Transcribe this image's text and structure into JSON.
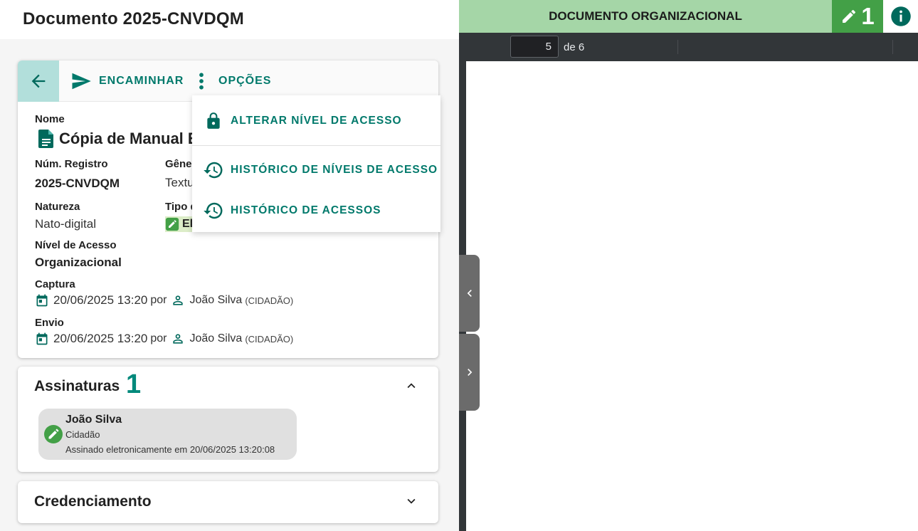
{
  "header": {
    "title": "Documento 2025-CNVDQM"
  },
  "toolbar": {
    "forward_label": "ENCAMINHAR",
    "options_label": "OPÇÕES"
  },
  "options_menu": {
    "items": [
      {
        "label": "ALTERAR NÍVEL DE ACESSO",
        "icon": "lock-icon"
      },
      {
        "label": "HISTÓRICO DE NÍVEIS DE ACESSO",
        "icon": "history-icon"
      },
      {
        "label": "HISTÓRICO DE ACESSOS",
        "icon": "history-icon"
      }
    ]
  },
  "details": {
    "name_label": "Nome",
    "name_value": "Cópia de Manual E-",
    "registro_label": "Núm. Registro",
    "registro_value": "2025-CNVDQM",
    "genero_label": "Gêner",
    "genero_value": "Textu",
    "natureza_label": "Natureza",
    "natureza_value": "Nato-digital",
    "tipo_label": "Tipo d",
    "tipo_value": "El",
    "acesso_label": "Nível de Acesso",
    "acesso_value": "Organizacional",
    "captura_label": "Captura",
    "captura_date": "20/06/2025 13:20",
    "captura_by": "por",
    "captura_user": "João Silva",
    "captura_role": "(CIDADÃO)",
    "envio_label": "Envio",
    "envio_date": "20/06/2025 13:20",
    "envio_by": "por",
    "envio_user": "João Silva",
    "envio_role": "(CIDADÃO)"
  },
  "signatures": {
    "title": "Assinaturas",
    "count": "1",
    "items": [
      {
        "name": "João Silva",
        "role": "Cidadão",
        "detail": "Assinado eletronicamente em 20/06/2025 13:20:08"
      }
    ]
  },
  "credenciamento": {
    "title": "Credenciamento"
  },
  "viewer": {
    "title": "DOCUMENTO ORGANIZACIONAL",
    "signature_count": "1",
    "current_page": "5",
    "page_of": "de 6"
  },
  "colors": {
    "accent": "#00796b",
    "header_green": "#a5d6a7",
    "badge_green": "#43a047",
    "pdf_toolbar": "#323639"
  }
}
